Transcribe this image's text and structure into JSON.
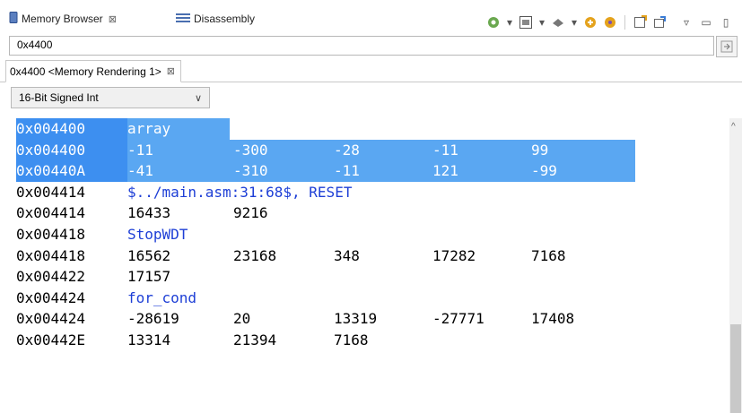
{
  "tabs": [
    {
      "label": "Memory Browser",
      "icon": "memory-chip-icon",
      "close": "⊠"
    },
    {
      "label": "Disassembly",
      "icon": "disassembly-icon"
    }
  ],
  "toolbar": {
    "icons": [
      "refresh-icon",
      "dropdown",
      "memory-view-icon",
      "dropdown",
      "connect-icon",
      "dropdown",
      "import-icon",
      "export-icon",
      "new-view-icon",
      "pin-icon",
      "view-menu-icon",
      "minimize-icon",
      "maximize-icon"
    ]
  },
  "address_input": {
    "value": "0x4400"
  },
  "rendering_tab": {
    "label": "0x4400 <Memory Rendering 1>",
    "close": "⊠"
  },
  "format_select": {
    "value": "16-Bit Signed Int"
  },
  "memory": {
    "rows": [
      {
        "addr": "0x004400",
        "symbol": "array",
        "values": [],
        "selected": true
      },
      {
        "addr": "0x004400",
        "symbol": "",
        "values": [
          "-11",
          "-300",
          "-28",
          "-11",
          "99"
        ],
        "selected": true
      },
      {
        "addr": "0x00440A",
        "symbol": "",
        "values": [
          "-41",
          "-310",
          "-11",
          "121",
          "-99"
        ],
        "selected": true
      },
      {
        "addr": "0x004414",
        "symbol": "$../main.asm:31:68$, RESET",
        "values": [],
        "selected": false
      },
      {
        "addr": "0x004414",
        "symbol": "",
        "values": [
          "16433",
          "9216"
        ],
        "selected": false
      },
      {
        "addr": "0x004418",
        "symbol": "StopWDT",
        "values": [],
        "selected": false
      },
      {
        "addr": "0x004418",
        "symbol": "",
        "values": [
          "16562",
          "23168",
          "348",
          "17282",
          "7168"
        ],
        "selected": false
      },
      {
        "addr": "0x004422",
        "symbol": "",
        "values": [
          "17157"
        ],
        "selected": false
      },
      {
        "addr": "0x004424",
        "symbol": "for_cond",
        "values": [],
        "selected": false
      },
      {
        "addr": "0x004424",
        "symbol": "",
        "values": [
          "-28619",
          "20",
          "13319",
          "-27771",
          "17408"
        ],
        "selected": false
      },
      {
        "addr": "0x00442E",
        "symbol": "",
        "values": [
          "13314",
          "21394",
          "7168"
        ],
        "selected": false
      }
    ]
  },
  "colors": {
    "selection": "#5aa7f2",
    "selection_addr": "#3d8ff0",
    "symbol": "#1e3fd6"
  }
}
